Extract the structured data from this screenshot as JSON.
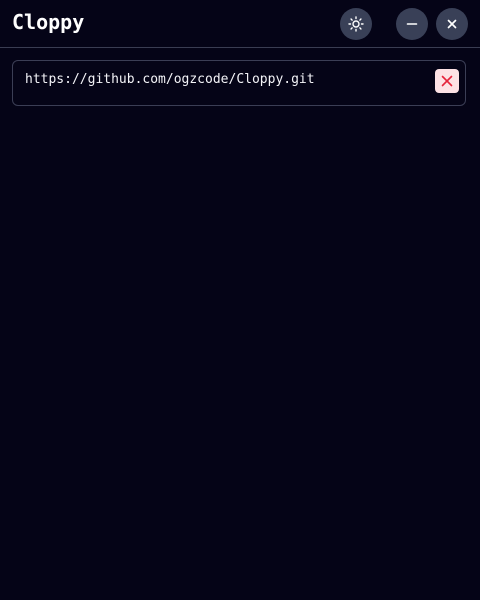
{
  "app": {
    "title": "Cloppy"
  },
  "titlebar": {
    "buttons": {
      "theme": "sun-icon",
      "minimize": "minus-icon",
      "close": "close-icon"
    }
  },
  "repo": {
    "url": "https://github.com/ogzcode/Cloppy.git",
    "remove_icon": "close-icon"
  },
  "colors": {
    "background": "#050417",
    "button_bg": "#394057",
    "border": "#3b3e55",
    "remove_bg": "#fde2e5",
    "remove_icon": "#e5233b"
  }
}
